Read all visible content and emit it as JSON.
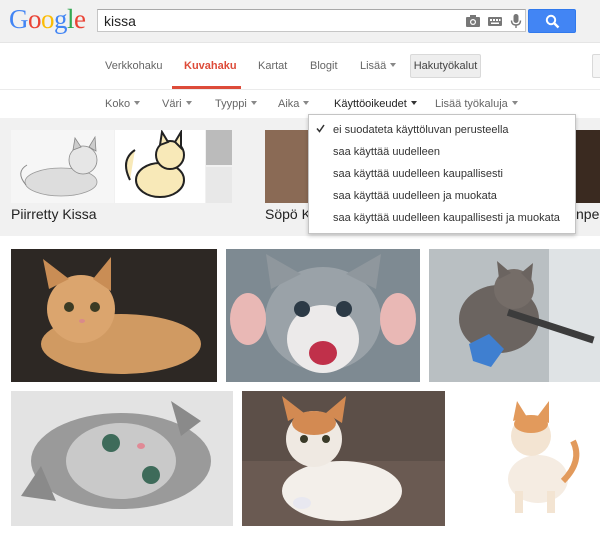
{
  "logo": {
    "letters": [
      "G",
      "o",
      "o",
      "g",
      "l",
      "e"
    ],
    "colors": [
      "#4285f4",
      "#ea4335",
      "#fbbc05",
      "#4285f4",
      "#34a853",
      "#ea4335"
    ]
  },
  "search": {
    "query": "kissa",
    "camera_icon": "camera-icon",
    "keyboard_icon": "keyboard-icon",
    "mic_icon": "mic-icon",
    "button_icon": "search-icon"
  },
  "nav": {
    "items": [
      "Verkkohaku",
      "Kuvahaku",
      "Kartat",
      "Blogit",
      "Lisää"
    ],
    "active": "Kuvahaku",
    "tools_label": "Hakutyökalut"
  },
  "filters": [
    "Koko",
    "Väri",
    "Tyyppi",
    "Aika",
    "Käyttöoikeudet",
    "Lisää työkaluja"
  ],
  "open_filter": "Käyttöoikeudet",
  "related": {
    "labels": [
      "Piirretty Kissa",
      "Söpö K",
      "npe"
    ]
  },
  "license_menu": {
    "selected_index": 0,
    "items": [
      "ei suodateta käyttöluvan perusteella",
      "saa käyttää uudelleen",
      "saa käyttää uudelleen kaupallisesti",
      "saa käyttää uudelleen ja muokata",
      "saa käyttää uudelleen kaupallisesti ja muokata"
    ]
  },
  "colors": {
    "accent_red": "#dd4b39",
    "search_blue": "#4285f4"
  }
}
